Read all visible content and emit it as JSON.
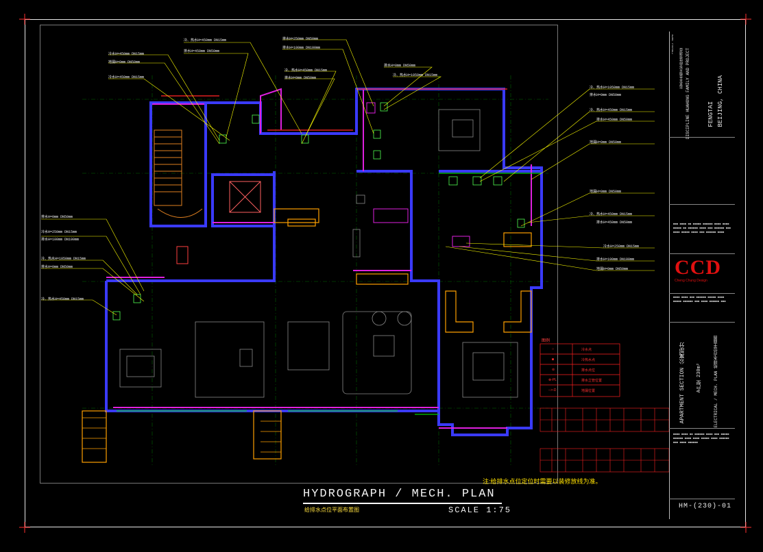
{
  "drawing": {
    "title": "HYDROGRAPH / MECH. PLAN",
    "subtitle": "给排水点位平面布置图",
    "scale": "SCALE 1:75",
    "note": "注:给排水点位定位时需要以装修放线为准。"
  },
  "title_block": {
    "project_top": "PROJECT NAME",
    "project_cn": "北京丰台恒大华府住宅项目",
    "project_en": "DISCIPLINE HUAHONG FAMILY AND PROJECT",
    "location": "FENGTAI\nBEIJING, CHINA",
    "company": "CCD",
    "company_sub": "Cheng Chung Design",
    "sheet_title": "APARTMENT SECTION  公寓部分",
    "sheet_area": "A户型 230m²",
    "sheet_type": "ELECTRICAL / MECH. PLAN  给排水点位平面图",
    "drawing_no": "HM-(230)-01"
  },
  "labels": [
    {
      "id": "l1",
      "text": "冷、热水H=450mm  DN15mm"
    },
    {
      "id": "l2",
      "text": "排水H=450mm  DN50mm"
    },
    {
      "id": "l3",
      "text": "冷水H=450mm  DN15mm"
    },
    {
      "id": "l4",
      "text": "地漏H=0mm  DN50mm"
    },
    {
      "id": "l5",
      "text": "冷水H=450mm  DN15mm"
    },
    {
      "id": "l6",
      "text": "排水H=250mm  DN50mm"
    },
    {
      "id": "l7",
      "text": "排水H=100mm  DN100mm"
    },
    {
      "id": "l8",
      "text": "冷、热水H=450mm  DN15mm"
    },
    {
      "id": "l9",
      "text": "排水H=0mm  DN50mm"
    },
    {
      "id": "l10",
      "text": "排水H=0mm  DN50mm"
    },
    {
      "id": "l11",
      "text": "冷、热水H=1050mm  DN15mm"
    },
    {
      "id": "l12",
      "text": "冷、热水H=1050mm  DN15mm"
    },
    {
      "id": "l13",
      "text": "排水H=0mm  DN50mm"
    },
    {
      "id": "l14",
      "text": "冷、热水H=450mm  DN15mm"
    },
    {
      "id": "l15",
      "text": "排水H=450mm  DN50mm"
    },
    {
      "id": "l16",
      "text": "地漏H=0mm  DN50mm"
    },
    {
      "id": "l17",
      "text": "地漏H=0mm  DN50mm"
    },
    {
      "id": "l18",
      "text": "冷、热水H=450mm  DN15mm"
    },
    {
      "id": "l19",
      "text": "排水H=450mm  DN50mm"
    },
    {
      "id": "l20",
      "text": "冷水H=250mm  DN15mm"
    },
    {
      "id": "l21",
      "text": "排水H=100mm  DN100mm"
    },
    {
      "id": "l22",
      "text": "地漏H=0mm  DN50mm"
    },
    {
      "id": "l23",
      "text": "排水H=0mm  DN50mm"
    },
    {
      "id": "l24",
      "text": "冷水H=250mm  DN15mm"
    },
    {
      "id": "l25",
      "text": "排水H=100mm  DN100mm"
    },
    {
      "id": "l26",
      "text": "冷、热水H=1050mm  DN15mm"
    },
    {
      "id": "l27",
      "text": "排水H=0mm  DN50mm"
    },
    {
      "id": "l28",
      "text": "冷、热水H=450mm  DN15mm"
    }
  ],
  "legend": {
    "title": "图例",
    "items": [
      {
        "symbol": "○",
        "text": "冷水点"
      },
      {
        "symbol": "◙",
        "text": "冷热水点"
      },
      {
        "symbol": "⊚",
        "text": "排水点位"
      },
      {
        "symbol": "⊗-PL",
        "text": "排水立管位置"
      },
      {
        "symbol": "-->-D",
        "text": "地漏位置"
      }
    ]
  },
  "colors": {
    "wall": "#3a3aff",
    "wall_alt": "#e020e0",
    "furniture": "#9a9a9a",
    "accent": "#ffa000",
    "leader": "#ffff00",
    "table": "#ff2020",
    "grid": "#00aa00"
  }
}
